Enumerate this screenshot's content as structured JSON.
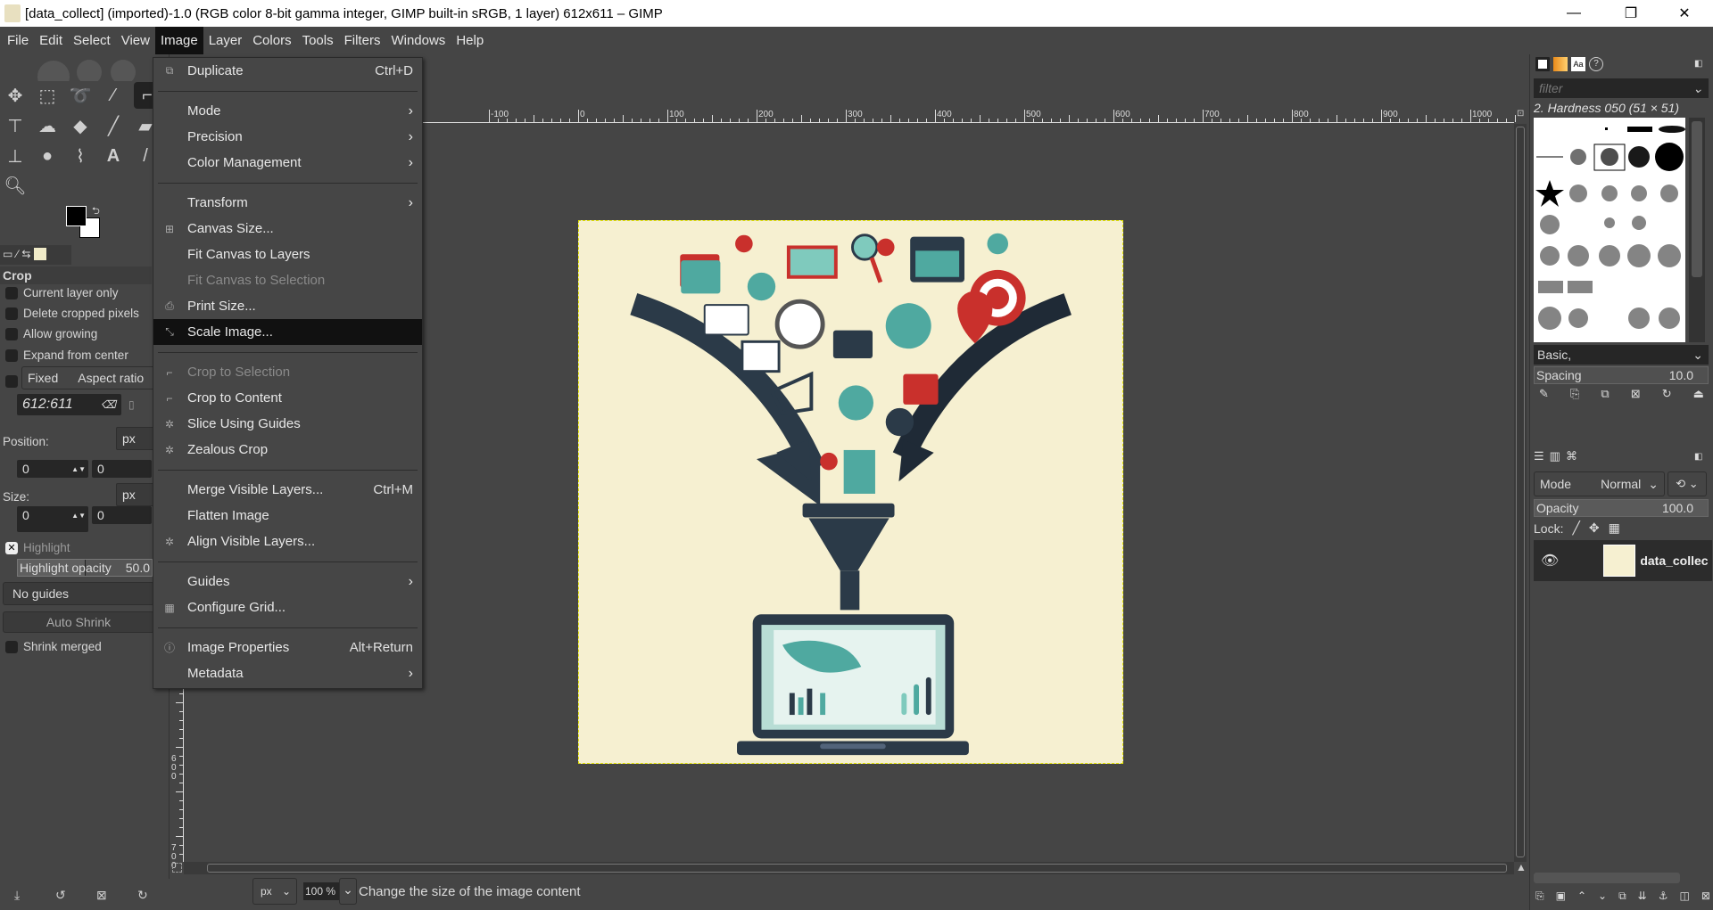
{
  "window": {
    "title": "[data_collect] (imported)-1.0 (RGB color 8-bit gamma integer, GIMP built-in sRGB, 1 layer) 612x611 – GIMP",
    "minimize": "—",
    "restore": "❐",
    "close": "✕"
  },
  "menubar": [
    "File",
    "Edit",
    "Select",
    "View",
    "Image",
    "Layer",
    "Colors",
    "Tools",
    "Filters",
    "Windows",
    "Help"
  ],
  "image_menu": [
    {
      "label": "Duplicate",
      "shortcut": "Ctrl+D",
      "icon": "duplicate-icon"
    },
    {
      "sep": true
    },
    {
      "label": "Mode",
      "submenu": true
    },
    {
      "label": "Precision",
      "submenu": true
    },
    {
      "label": "Color Management",
      "submenu": true
    },
    {
      "sep": true
    },
    {
      "label": "Transform",
      "submenu": true
    },
    {
      "label": "Canvas Size...",
      "icon": "canvas-size-icon"
    },
    {
      "label": "Fit Canvas to Layers"
    },
    {
      "label": "Fit Canvas to Selection",
      "disabled": true
    },
    {
      "label": "Print Size...",
      "icon": "print-icon"
    },
    {
      "label": "Scale Image...",
      "icon": "scale-icon",
      "highlighted": true
    },
    {
      "sep": true
    },
    {
      "label": "Crop to Selection",
      "icon": "crop-icon",
      "disabled": true
    },
    {
      "label": "Crop to Content",
      "icon": "crop-icon"
    },
    {
      "label": "Slice Using Guides",
      "icon": "plugin-icon"
    },
    {
      "label": "Zealous Crop",
      "icon": "plugin-icon"
    },
    {
      "sep": true
    },
    {
      "label": "Merge Visible Layers...",
      "shortcut": "Ctrl+M"
    },
    {
      "label": "Flatten Image"
    },
    {
      "label": "Align Visible Layers...",
      "icon": "plugin-icon"
    },
    {
      "sep": true
    },
    {
      "label": "Guides",
      "submenu": true
    },
    {
      "label": "Configure Grid...",
      "icon": "grid-icon"
    },
    {
      "sep": true
    },
    {
      "label": "Image Properties",
      "shortcut": "Alt+Return",
      "icon": "info-icon"
    },
    {
      "label": "Metadata",
      "submenu": true
    }
  ],
  "tool_options": {
    "title": "Crop",
    "current_layer_only": "Current layer only",
    "delete_cropped": "Delete cropped pixels",
    "allow_growing": "Allow growing",
    "expand_from_center": "Expand from center",
    "fixed": "Fixed",
    "fixed_mode": "Aspect ratio",
    "ratio": "612:611",
    "position_label": "Position:",
    "position_unit": "px",
    "position_x": "0",
    "position_y": "0",
    "size_label": "Size:",
    "size_unit": "px",
    "size_x": "0",
    "size_y": "0",
    "highlight": "Highlight",
    "highlight_opacity_label": "Highlight opacity",
    "highlight_opacity": "50.0",
    "guides": "No guides",
    "auto_shrink": "Auto Shrink",
    "shrink_merged": "Shrink merged"
  },
  "ruler": {
    "top": [
      "-100",
      "0",
      "100",
      "200",
      "300",
      "400",
      "500",
      "600",
      "700",
      "800",
      "900",
      "1000"
    ],
    "left": [
      "600",
      "700"
    ]
  },
  "status": {
    "unit": "px",
    "zoom": "100 %",
    "message": "Change the size of the image content"
  },
  "brushes": {
    "filter_placeholder": "filter",
    "current": "2. Hardness 050 (51 × 51)",
    "tag": "Basic,",
    "spacing_label": "Spacing",
    "spacing": "10.0"
  },
  "layers": {
    "mode_label": "Mode",
    "mode": "Normal",
    "opacity_label": "Opacity",
    "opacity": "100.0",
    "lock_label": "Lock:",
    "layer_name": "data_collec"
  },
  "colors": {
    "accent_teal": "#4fa9a0",
    "accent_red": "#c9302c",
    "navy": "#2b3a48",
    "canvas_bg": "#f6f0d1"
  }
}
